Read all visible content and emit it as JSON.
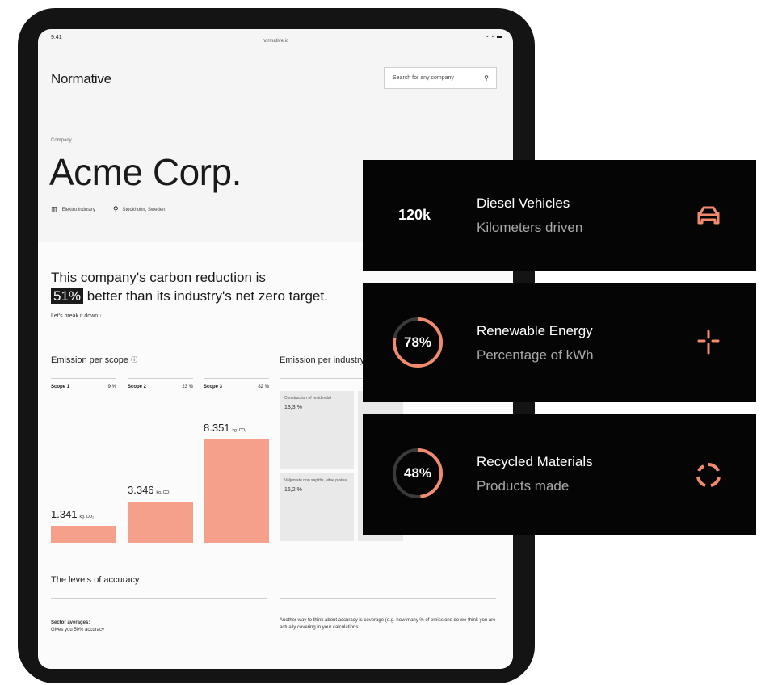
{
  "status_bar": {
    "time": "9:41",
    "url": "normative.io",
    "icons": "▪ ▪ ▬"
  },
  "header": {
    "brand": "Normative",
    "search_placeholder": "Search for any company",
    "search_icon": "search-icon"
  },
  "company": {
    "label": "Company",
    "name": "Acme Corp.",
    "industry": "Elektro industry",
    "location": "Stockholm, Sweden"
  },
  "claim": {
    "line1": "This company's carbon reduction is",
    "highlight": "51%",
    "line2": " better than its industry's net zero target."
  },
  "breakdown_link": "Let's break it down ↓",
  "emission_scope": {
    "title": "Emission per scope",
    "info_icon": "info-icon",
    "scopes": [
      {
        "name": "Scope 1",
        "pct": "9 %",
        "value": "1.341",
        "unit": "kg. CO₂",
        "amount": 1341
      },
      {
        "name": "Scope 2",
        "pct": "23 %",
        "value": "3.346",
        "unit": "kg. CO₂",
        "amount": 3346
      },
      {
        "name": "Scope 3",
        "pct": "82 %",
        "value": "8.351",
        "unit": "kg. CO₂",
        "amount": 8351
      }
    ]
  },
  "emission_industry": {
    "title": "Emission per industry",
    "cells": [
      {
        "label": "Construction of residential",
        "value": "13,3 %"
      },
      {
        "label": "Valjuotate non sagittis, vitae platea",
        "value": "16,2 %"
      }
    ]
  },
  "accuracy": {
    "title": "The levels of accuracy",
    "sector_title": "Sector averages:",
    "sector_text": "Gives you 50% accuracy",
    "coverage_text": "Another way to think about accuracy is coverage (e.g. how many % of emissions do we think you are actually covering in your calculations."
  },
  "cards": [
    {
      "value": "120k",
      "title": "Diesel Vehicles",
      "subtitle": "Kilometers driven",
      "icon": "vehicle-icon"
    },
    {
      "value": "78%",
      "title": "Renewable Energy",
      "subtitle": "Percentage of kWh",
      "icon": "wind-turbine-icon",
      "progress": 0.78
    },
    {
      "value": "48%",
      "title": "Recycled Materials",
      "subtitle": "Products made",
      "icon": "recycle-icon",
      "progress": 0.48
    }
  ],
  "colors": {
    "accent": "#f28b6e",
    "card_bg": "#050505",
    "bar": "#f4a08a"
  }
}
